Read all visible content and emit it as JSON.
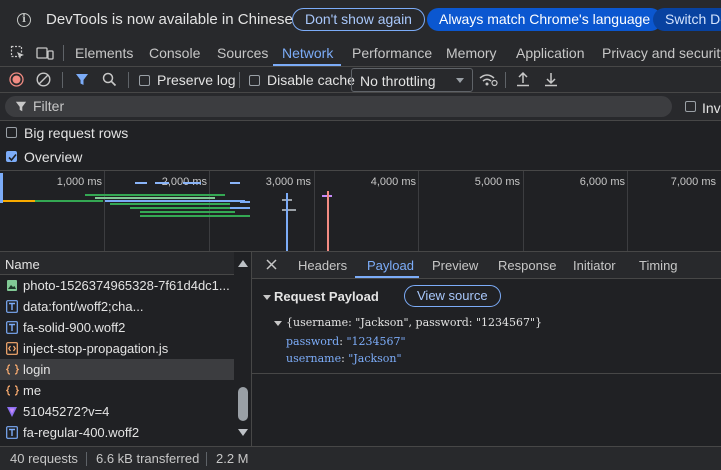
{
  "infobar": {
    "message": "DevTools is now available in Chinese",
    "dont_show": "Don't show again",
    "match_language": "Always match Chrome's language",
    "switch": "Switch Dev"
  },
  "tabs": {
    "items": [
      "Elements",
      "Console",
      "Sources",
      "Network",
      "Performance",
      "Memory",
      "Application",
      "Privacy and security"
    ],
    "active": "Network"
  },
  "toolbar": {
    "preserve_log": "Preserve log",
    "disable_cache": "Disable cache",
    "throttling": "No throttling"
  },
  "filter": {
    "placeholder": "Filter",
    "invert": "Inv"
  },
  "options": {
    "big_rows": "Big request rows",
    "big_rows_checked": false,
    "overview": "Overview",
    "overview_checked": true
  },
  "timeline": {
    "ticks": [
      "1,000 ms",
      "2,000 ms",
      "3,000 ms",
      "4,000 ms",
      "5,000 ms",
      "6,000 ms",
      "7,000 ms"
    ]
  },
  "requests": {
    "header": "Name",
    "rows": [
      {
        "name": "photo-1526374965328-7f61d4dc1...",
        "icon": "image-icon"
      },
      {
        "name": "data:font/woff2;cha...",
        "icon": "font-icon"
      },
      {
        "name": "fa-solid-900.woff2",
        "icon": "font-icon"
      },
      {
        "name": "inject-stop-propagation.js",
        "icon": "script-icon"
      },
      {
        "name": "login",
        "icon": "fetch-icon",
        "selected": true
      },
      {
        "name": "me",
        "icon": "fetch-icon"
      },
      {
        "name": "51045272?v=4",
        "icon": "image-icon"
      },
      {
        "name": "fa-regular-400.woff2",
        "icon": "font-icon"
      }
    ]
  },
  "detail": {
    "tabs": [
      "Headers",
      "Payload",
      "Preview",
      "Response",
      "Initiator",
      "Timing"
    ],
    "active_tab": "Payload",
    "section_title": "Request Payload",
    "view_source": "View source",
    "summary": "{username: \"Jackson\", password: \"1234567\"}",
    "properties": [
      {
        "key": "password",
        "value": "\"1234567\""
      },
      {
        "key": "username",
        "value": "\"Jackson\""
      }
    ]
  },
  "status": {
    "requests": "40 requests",
    "transferred": "6.6 kB transferred",
    "resources": "2.2 M"
  }
}
